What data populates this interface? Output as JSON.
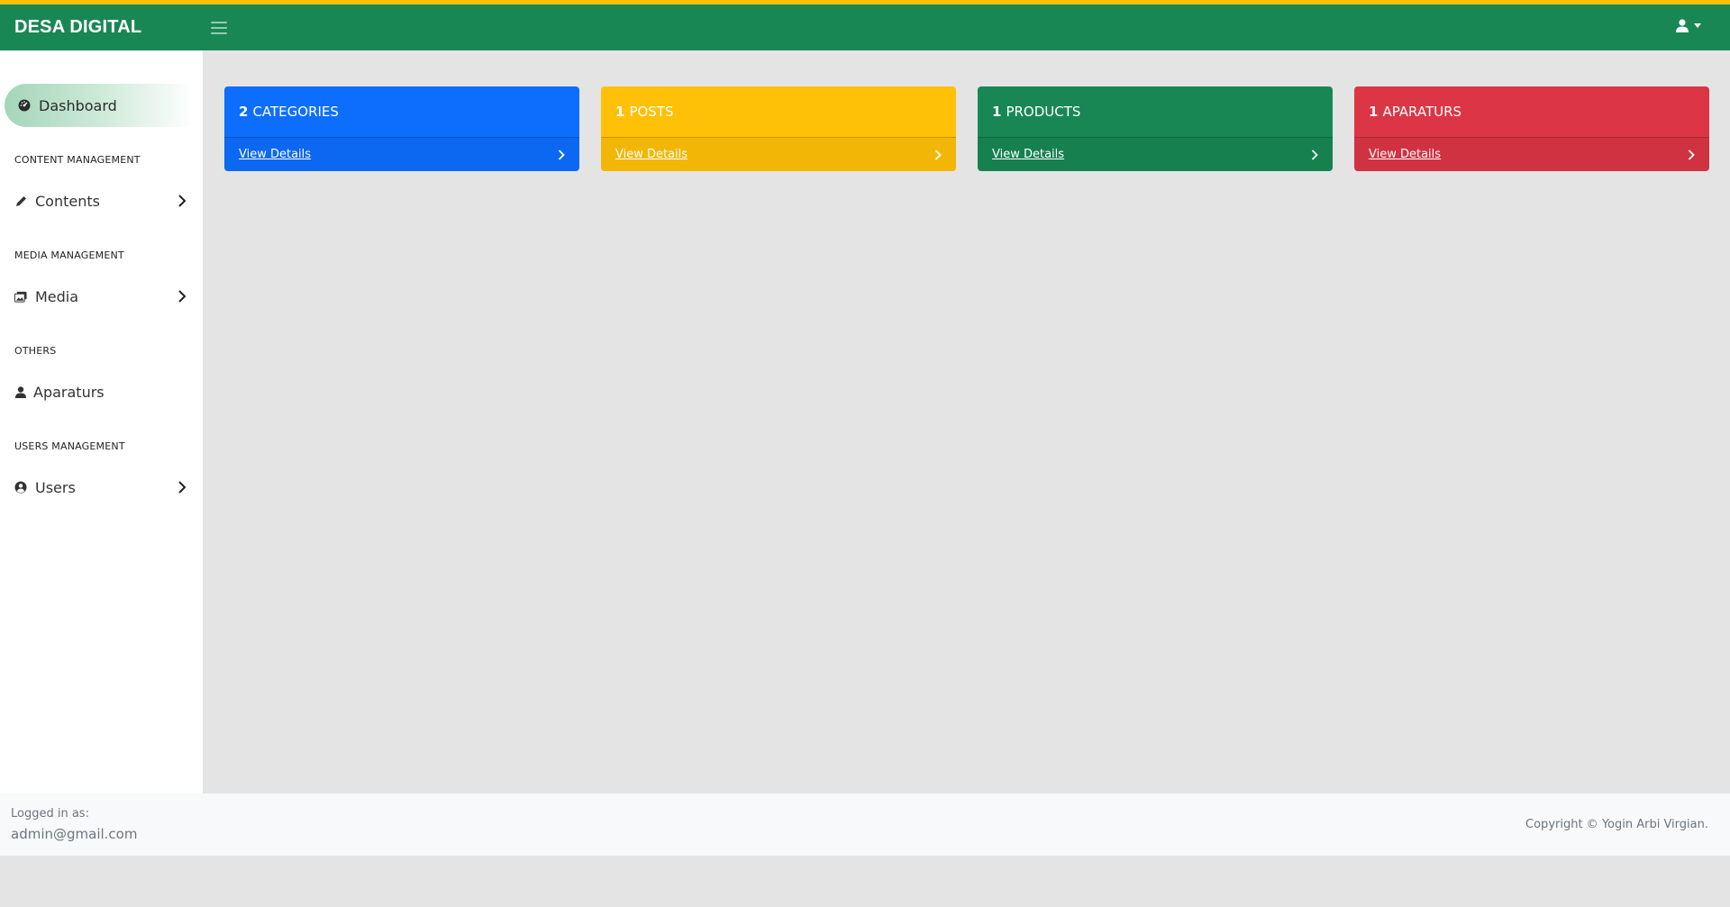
{
  "app": {
    "brand": "DESA DIGITAL"
  },
  "header": {
    "user_icon": "user-icon",
    "caret_icon": "caret-down-icon"
  },
  "sidebar": {
    "dashboard": {
      "label": "Dashboard",
      "icon": "gauge-icon"
    },
    "sections": [
      {
        "title": "CONTENT MANAGEMENT",
        "item": {
          "label": "Contents",
          "icon": "pencil-icon",
          "has_submenu": true
        }
      },
      {
        "title": "MEDIA MANAGEMENT",
        "item": {
          "label": "Media",
          "icon": "images-icon",
          "has_submenu": true
        }
      },
      {
        "title": "OTHERS",
        "item": {
          "label": "Aparaturs",
          "icon": "user-icon",
          "has_submenu": false
        }
      },
      {
        "title": "USERS MANAGEMENT",
        "item": {
          "label": "Users",
          "icon": "user-circle-icon",
          "has_submenu": true
        }
      }
    ]
  },
  "cards": [
    {
      "count": "2",
      "label": "CATEGORIES",
      "link": "View Details",
      "color": "#0d6efd"
    },
    {
      "count": "1",
      "label": "POSTS",
      "link": "View Details",
      "color": "#ffc107"
    },
    {
      "count": "1",
      "label": "PRODUCTS",
      "link": "View Details",
      "color": "#198754"
    },
    {
      "count": "1",
      "label": "APARATURS",
      "link": "View Details",
      "color": "#dc3545"
    }
  ],
  "footer": {
    "logged_in_label": "Logged in as:",
    "email": "admin@gmail.com",
    "copyright": "Copyright © Yogin Arbi Virgian."
  },
  "colors": {
    "topbar": "#198754",
    "accent_stripe": "#ffc107"
  }
}
